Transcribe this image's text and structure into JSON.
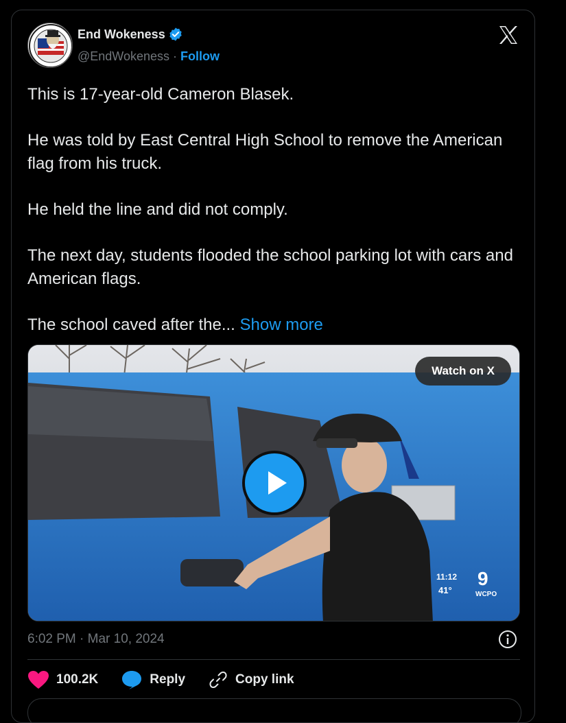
{
  "tweet": {
    "author": {
      "name": "End Wokeness",
      "handle": "@EndWokeness",
      "separator": " · ",
      "follow_label": "Follow",
      "avatar_icon": "uncle-sam-badge-icon",
      "verified_icon": "verified-badge-icon"
    },
    "brand_icon": "x-logo-icon",
    "paragraphs": [
      "This is 17-year-old Cameron Blasek.",
      "He was told by East Central High School to remove the American flag from his truck.",
      "He held the line and did not comply.",
      "The next day, students flooded the school parking lot with cars and American flags."
    ],
    "truncated_text": "The school caved after the...",
    "show_more_label": "Show more",
    "media": {
      "watch_label": "Watch on X",
      "play_icon": "play-icon",
      "overlay_time": "11:12",
      "overlay_temp": "41°",
      "overlay_channel": "WCPO",
      "overlay_channel_number": "9"
    },
    "timestamp": "6:02 PM · Mar 10, 2024",
    "info_icon": "info-icon",
    "actions": {
      "like_count": "100.2K",
      "reply_label": "Reply",
      "copy_label": "Copy link"
    },
    "colors": {
      "accent": "#1d9bf0",
      "like": "#f91880",
      "background": "#000000"
    }
  }
}
